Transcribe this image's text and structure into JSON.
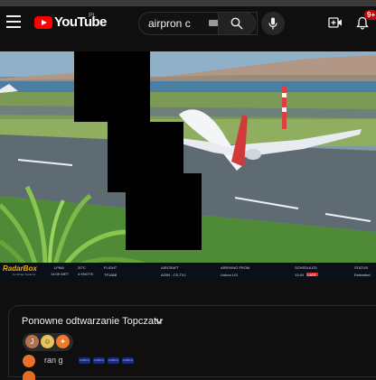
{
  "header": {
    "logo_text": "YouTube",
    "region": "PL",
    "search_value": "airpron c",
    "notification_count": "9+"
  },
  "video": {
    "overlay": {
      "brand": "RadarBox",
      "brand_sub": "by AirNav Systems",
      "location": "LPMA",
      "local_time": "14:09 WET",
      "temperature": "20°C",
      "wind": "4 KNOTS",
      "headers": [
        "FLIGHT",
        "AIRCRAFT",
        "ARRIVING FROM",
        "SCHEDULED",
        "STATUS"
      ],
      "flight": "TP1688",
      "aircraft": "A20N - CS-TXJ",
      "arriving_from": "Lisbon LIS",
      "scheduled": "13:40",
      "late_label": "LATE",
      "status": "Estimated"
    }
  },
  "chat": {
    "title": "Ponowne odtwarzanie Topczatu",
    "reaction_initial": "J",
    "message_author": "ran g",
    "chips": [
      "AIRBUS",
      "AIRBUS",
      "AIRBUS",
      "AIRBUS"
    ]
  },
  "colors": {
    "accent": "#ff0000",
    "background": "#0f0f0f",
    "late": "#d62b2b"
  }
}
